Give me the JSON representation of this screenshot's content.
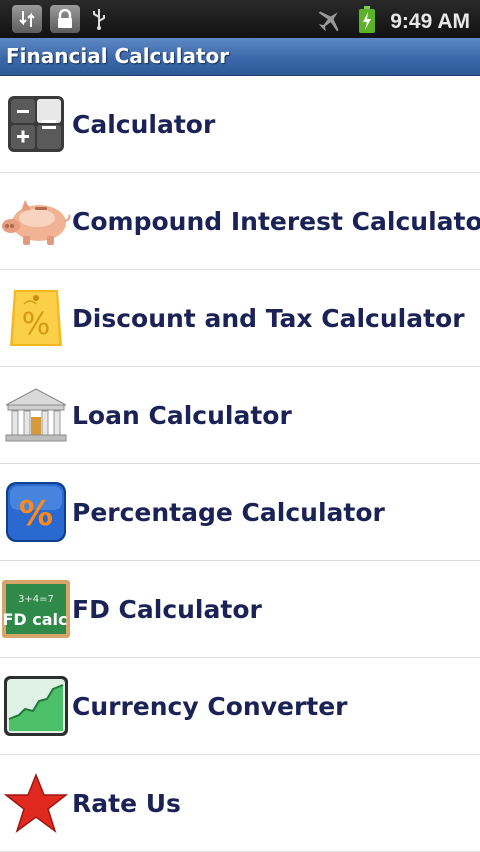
{
  "status_bar": {
    "time": "9:49 AM"
  },
  "app": {
    "title": "Financial Calculator"
  },
  "menu": {
    "items": [
      {
        "label": "Calculator",
        "icon": "calculator-icon"
      },
      {
        "label": "Compound Interest Calculator",
        "icon": "piggy-bank-icon"
      },
      {
        "label": "Discount and Tax Calculator",
        "icon": "discount-tag-icon"
      },
      {
        "label": "Loan Calculator",
        "icon": "bank-icon"
      },
      {
        "label": "Percentage Calculator",
        "icon": "percent-icon"
      },
      {
        "label": "FD Calculator",
        "icon": "chalkboard-icon",
        "icon_text": "FD calc",
        "icon_subtext": "3+4=7"
      },
      {
        "label": "Currency Converter",
        "icon": "chart-icon"
      },
      {
        "label": "Rate Us",
        "icon": "star-icon"
      }
    ]
  },
  "colors": {
    "title_bar": "#3c68a9",
    "label_text": "#1b2255",
    "divider": "#dcdcdc"
  }
}
